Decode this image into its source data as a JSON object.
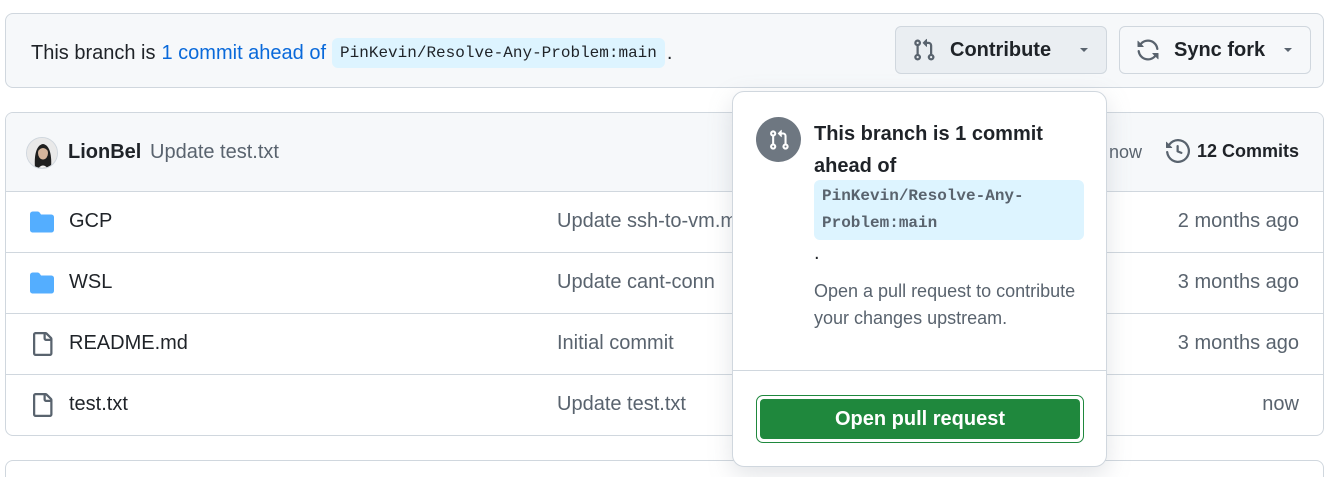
{
  "ahead_bar": {
    "prefix": "This branch is",
    "link": "1 commit ahead of",
    "ref": "PinKevin/Resolve-Any-Problem:main",
    "suffix": "."
  },
  "buttons": {
    "contribute": "Contribute",
    "sync_fork": "Sync fork"
  },
  "latest_commit": {
    "author": "LionBel",
    "message": "Update test.txt",
    "time": "now",
    "commits_count": "12 Commits"
  },
  "files": [
    {
      "name": "GCP",
      "type": "folder",
      "message": "Update ssh-to-vm.m",
      "date": "2 months ago"
    },
    {
      "name": "WSL",
      "type": "folder",
      "message": "Update cant-conn",
      "date": "3 months ago"
    },
    {
      "name": "README.md",
      "type": "file",
      "message": "Initial commit",
      "date": "3 months ago"
    },
    {
      "name": "test.txt",
      "type": "file",
      "message": "Update test.txt",
      "date": "now"
    }
  ],
  "popover": {
    "title": "This branch is 1 commit ahead of",
    "ref": "PinKevin/Resolve-Any-Problem:main",
    "dot": ".",
    "description": "Open a pull request to contribute your changes upstream.",
    "button": "Open pull request"
  },
  "colors": {
    "link": "#0969da",
    "primary_button": "#1f883d",
    "ref_background": "#ddf4ff",
    "folder_icon": "#54aeff"
  },
  "icons": [
    "git-pull-request-icon",
    "sync-icon",
    "chevron-down-icon",
    "history-icon",
    "folder-icon",
    "file-icon",
    "avatar"
  ]
}
